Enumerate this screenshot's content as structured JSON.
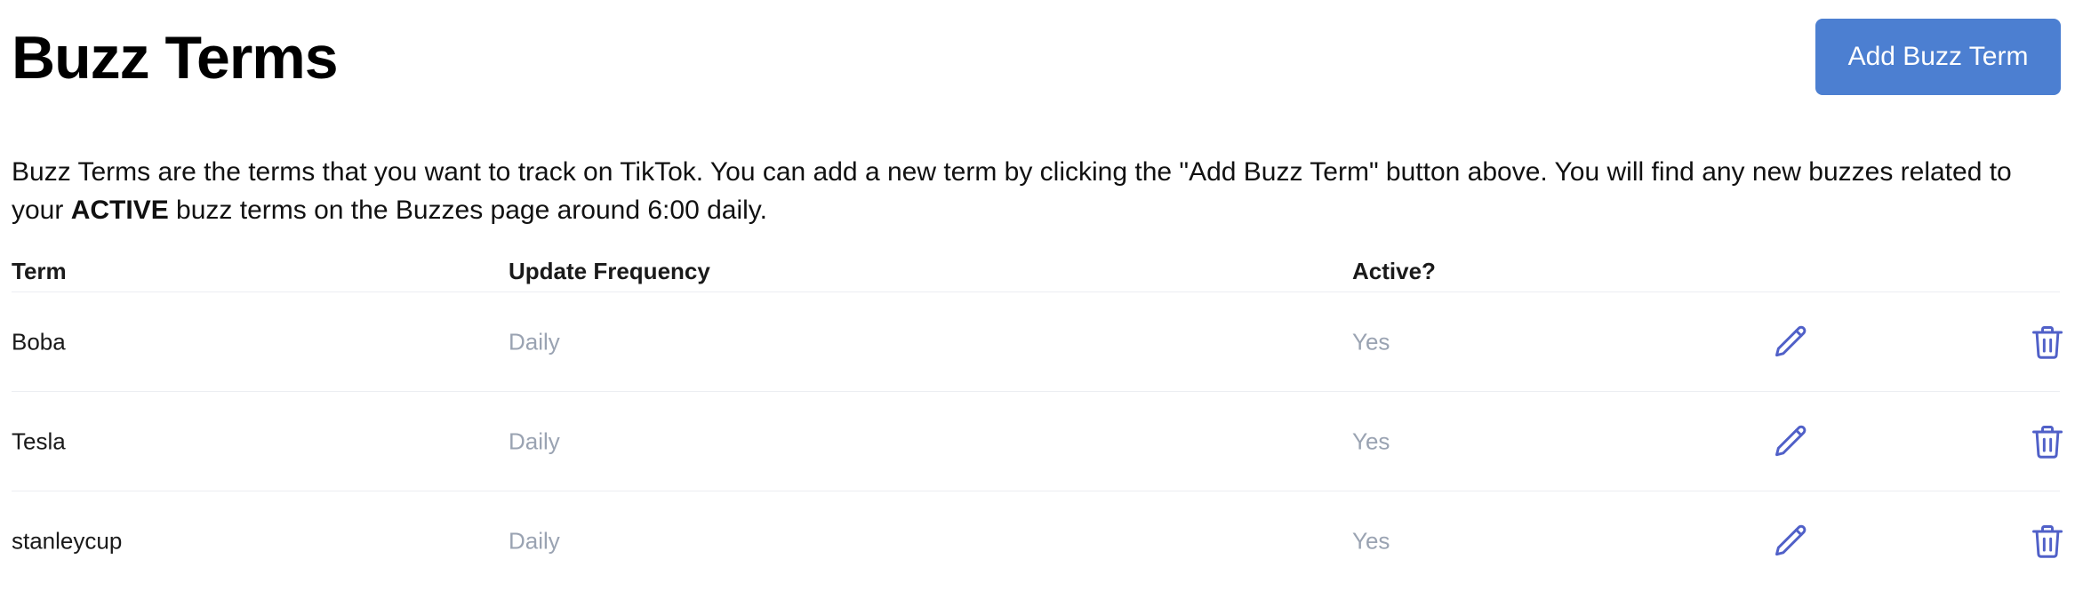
{
  "header": {
    "title": "Buzz Terms",
    "add_button_label": "Add Buzz Term"
  },
  "description": {
    "text_before": "Buzz Terms are the terms that you want to track on TikTok. You can add a new term by clicking the \"Add Buzz Term\" button above. You will find any new buzzes related to your ",
    "emphasis": "ACTIVE",
    "text_after": " buzz terms on the Buzzes page around 6:00 daily."
  },
  "table": {
    "columns": {
      "term": "Term",
      "frequency": "Update Frequency",
      "active": "Active?"
    },
    "rows": [
      {
        "term": "Boba",
        "frequency": "Daily",
        "active": "Yes"
      },
      {
        "term": "Tesla",
        "frequency": "Daily",
        "active": "Yes"
      },
      {
        "term": "stanleycup",
        "frequency": "Daily",
        "active": "Yes"
      }
    ]
  },
  "icons": {
    "edit": "pencil-icon",
    "delete": "trash-icon"
  },
  "colors": {
    "primary_button": "#4c7fd1",
    "icon": "#5060c8",
    "muted_text": "#9aa3b2"
  }
}
